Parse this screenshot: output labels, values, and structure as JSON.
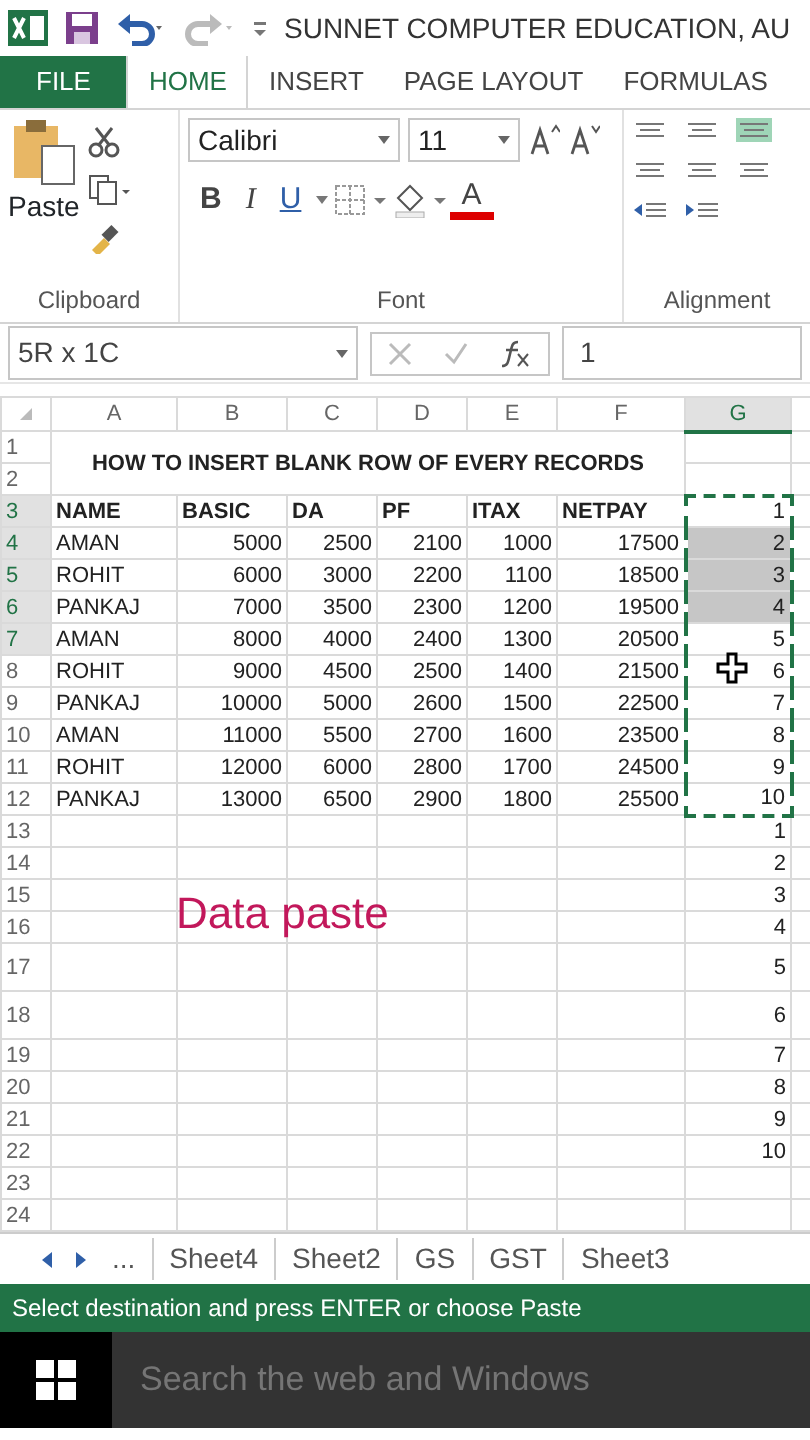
{
  "title_bar": {
    "title": "SUNNET COMPUTER EDUCATION, AU"
  },
  "ribbon_tabs": [
    {
      "label": "FILE",
      "kind": "file",
      "selected": false
    },
    {
      "label": "HOME",
      "kind": "tab",
      "selected": true
    },
    {
      "label": "INSERT",
      "kind": "tab",
      "selected": false
    },
    {
      "label": "PAGE LAYOUT",
      "kind": "tab",
      "selected": false
    },
    {
      "label": "FORMULAS",
      "kind": "tab",
      "selected": false
    }
  ],
  "ribbon": {
    "clipboard": {
      "paste_label": "Paste",
      "group_label": "Clipboard"
    },
    "font": {
      "font_name": "Calibri",
      "font_size": "11",
      "bold": "B",
      "italic": "I",
      "underline": "U",
      "font_color": "A",
      "group_label": "Font"
    },
    "alignment": {
      "group_label": "Alignment"
    }
  },
  "formula_bar": {
    "name_box": "5R x 1C",
    "value": "1"
  },
  "columns": [
    {
      "label": "A",
      "selected": false
    },
    {
      "label": "B",
      "selected": false
    },
    {
      "label": "C",
      "selected": false
    },
    {
      "label": "D",
      "selected": false
    },
    {
      "label": "E",
      "selected": false
    },
    {
      "label": "F",
      "selected": false
    },
    {
      "label": "G",
      "selected": true
    }
  ],
  "sheet_title": "HOW TO INSERT BLANK ROW OF EVERY RECORDS",
  "rows": [
    {
      "number": "1",
      "kind": "title",
      "header_selected": false,
      "g_selected": false,
      "copy_range": false,
      "tall": false
    },
    {
      "number": "2",
      "kind": "title",
      "header_selected": false,
      "g_selected": false,
      "copy_range": false,
      "tall": false
    },
    {
      "number": "3",
      "kind": "header",
      "header_selected": true,
      "g_selected": false,
      "copy_range": true,
      "tall": false,
      "cells": [
        "NAME",
        "BASIC",
        "DA",
        "PF",
        "ITAX",
        "NETPAY",
        "1"
      ]
    },
    {
      "number": "4",
      "kind": "data",
      "header_selected": true,
      "g_selected": true,
      "copy_range": true,
      "tall": false,
      "cells": [
        "AMAN",
        "5000",
        "2500",
        "2100",
        "1000",
        "17500",
        "2"
      ]
    },
    {
      "number": "5",
      "kind": "data",
      "header_selected": true,
      "g_selected": true,
      "copy_range": true,
      "tall": false,
      "cells": [
        "ROHIT",
        "6000",
        "3000",
        "2200",
        "1100",
        "18500",
        "3"
      ]
    },
    {
      "number": "6",
      "kind": "data",
      "header_selected": true,
      "g_selected": true,
      "copy_range": true,
      "tall": false,
      "cells": [
        "PANKAJ",
        "7000",
        "3500",
        "2300",
        "1200",
        "19500",
        "4"
      ]
    },
    {
      "number": "7",
      "kind": "data",
      "header_selected": true,
      "g_selected": false,
      "copy_range": true,
      "tall": false,
      "cells": [
        "AMAN",
        "8000",
        "4000",
        "2400",
        "1300",
        "20500",
        "5"
      ]
    },
    {
      "number": "8",
      "kind": "data",
      "header_selected": false,
      "g_selected": false,
      "copy_range": true,
      "tall": false,
      "cells": [
        "ROHIT",
        "9000",
        "4500",
        "2500",
        "1400",
        "21500",
        "6"
      ]
    },
    {
      "number": "9",
      "kind": "data",
      "header_selected": false,
      "g_selected": false,
      "copy_range": true,
      "tall": false,
      "cells": [
        "PANKAJ",
        "10000",
        "5000",
        "2600",
        "1500",
        "22500",
        "7"
      ]
    },
    {
      "number": "10",
      "kind": "data",
      "header_selected": false,
      "g_selected": false,
      "copy_range": true,
      "tall": false,
      "cells": [
        "AMAN",
        "11000",
        "5500",
        "2700",
        "1600",
        "23500",
        "8"
      ]
    },
    {
      "number": "11",
      "kind": "data",
      "header_selected": false,
      "g_selected": false,
      "copy_range": true,
      "tall": false,
      "cells": [
        "ROHIT",
        "12000",
        "6000",
        "2800",
        "1700",
        "24500",
        "9"
      ]
    },
    {
      "number": "12",
      "kind": "data",
      "header_selected": false,
      "g_selected": false,
      "copy_range": true,
      "tall": false,
      "cells": [
        "PANKAJ",
        "13000",
        "6500",
        "2900",
        "1800",
        "25500",
        "10"
      ]
    },
    {
      "number": "13",
      "kind": "extra",
      "header_selected": false,
      "g_selected": false,
      "copy_range": false,
      "tall": false,
      "g": "1"
    },
    {
      "number": "14",
      "kind": "extra",
      "header_selected": false,
      "g_selected": false,
      "copy_range": false,
      "tall": false,
      "g": "2"
    },
    {
      "number": "15",
      "kind": "extra",
      "header_selected": false,
      "g_selected": false,
      "copy_range": false,
      "tall": false,
      "g": "3"
    },
    {
      "number": "16",
      "kind": "extra",
      "header_selected": false,
      "g_selected": false,
      "copy_range": false,
      "tall": false,
      "g": "4"
    },
    {
      "number": "17",
      "kind": "extra",
      "header_selected": false,
      "g_selected": false,
      "copy_range": false,
      "tall": true,
      "g": "5"
    },
    {
      "number": "18",
      "kind": "extra",
      "header_selected": false,
      "g_selected": false,
      "copy_range": false,
      "tall": true,
      "g": "6"
    },
    {
      "number": "19",
      "kind": "extra",
      "header_selected": false,
      "g_selected": false,
      "copy_range": false,
      "tall": false,
      "g": "7"
    },
    {
      "number": "20",
      "kind": "extra",
      "header_selected": false,
      "g_selected": false,
      "copy_range": false,
      "tall": false,
      "g": "8"
    },
    {
      "number": "21",
      "kind": "extra",
      "header_selected": false,
      "g_selected": false,
      "copy_range": false,
      "tall": false,
      "g": "9"
    },
    {
      "number": "22",
      "kind": "extra",
      "header_selected": false,
      "g_selected": false,
      "copy_range": false,
      "tall": false,
      "g": "10"
    },
    {
      "number": "23",
      "kind": "extra",
      "header_selected": false,
      "g_selected": false,
      "copy_range": false,
      "tall": false
    },
    {
      "number": "24",
      "kind": "extra",
      "header_selected": false,
      "g_selected": false,
      "copy_range": false,
      "tall": false
    }
  ],
  "annotation": {
    "text": "Data paste"
  },
  "sheet_tabs": {
    "more": "...",
    "tabs": [
      "Sheet4",
      "Sheet2",
      "GS",
      "GST",
      "Sheet3"
    ]
  },
  "status_bar": "Select destination and press ENTER or choose Paste",
  "taskbar": {
    "search_placeholder": "Search the web and Windows"
  }
}
